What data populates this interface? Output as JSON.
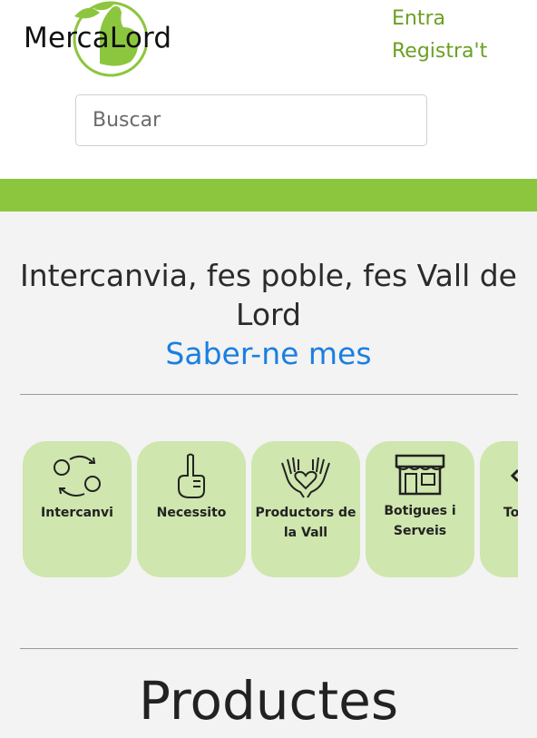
{
  "header": {
    "logo_text": "MercaLord",
    "login_label": "Entra",
    "register_label": "Registra't"
  },
  "search": {
    "placeholder": "Buscar"
  },
  "hero": {
    "tagline": "Intercanvia, fes poble, fes Vall de Lord",
    "link_label": "Saber-ne mes"
  },
  "categories": [
    {
      "label": "Intercanvi",
      "icon": "exchange-arrows-icon"
    },
    {
      "label": "Necessito",
      "icon": "pointing-hand-icon"
    },
    {
      "label": "Productors de la Vall",
      "icon": "hands-heart-icon"
    },
    {
      "label": "Botigues i Serveis",
      "icon": "storefront-icon"
    },
    {
      "label": "To Se",
      "icon": "chevron-left-icon"
    }
  ],
  "section": {
    "title": "Productes"
  },
  "colors": {
    "brand_green": "#8cc63f",
    "link_blue": "#1a7fe0",
    "card_green": "#cfe6ae",
    "auth_green": "#6aa023"
  }
}
